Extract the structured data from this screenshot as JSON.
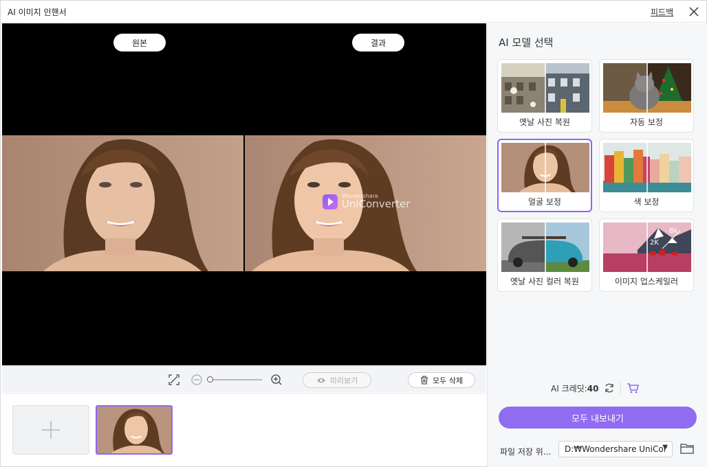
{
  "window": {
    "title": "AI 이미지 인핸서",
    "feedback_label": "피드백"
  },
  "preview": {
    "original_label": "원본",
    "result_label": "결과",
    "watermark_small": "Wondershare",
    "watermark_big": "UniConverter"
  },
  "toolbar": {
    "preview_label": "미리보기",
    "delete_all_label": "모두 삭제",
    "zoom_level": 0
  },
  "sidepanel": {
    "title": "AI 모델 선택",
    "models": [
      {
        "label": "옛날 사진 복원",
        "selected": false
      },
      {
        "label": "자동 보정",
        "selected": false
      },
      {
        "label": "얼굴 보정",
        "selected": true
      },
      {
        "label": "색 보정",
        "selected": false
      },
      {
        "label": "옛날 사진 컬러 복원",
        "selected": false
      },
      {
        "label": "이미지 업스케일러",
        "selected": false
      }
    ],
    "upscale_badges": [
      "2K",
      "8k"
    ],
    "credit_label": "AI 크레딧:",
    "credit_value": "40",
    "export_label": "모두 내보내기",
    "save_location_label": "파일 저장 위...",
    "save_location_value": "D:₩Wondershare UniCor"
  },
  "colors": {
    "accent": "#8f6cf0",
    "selected_border": "#8d65f2"
  }
}
